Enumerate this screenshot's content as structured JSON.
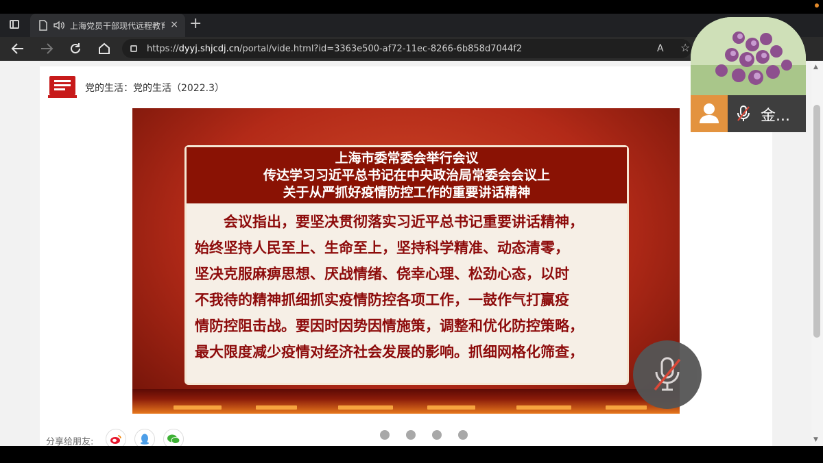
{
  "browser": {
    "tab_title": "上海党员干部现代远程教育",
    "tab_close": "×",
    "new_tab": "+",
    "url_prefix": "https://",
    "url_host": "dyyj.shjcdj.cn",
    "url_path": "/portal/vide.html?id=3363e500-af72-11ec-8266-6b858d7044f2",
    "read_aloud": "A",
    "favorite": "☆"
  },
  "page": {
    "breadcrumb": "党的生活：党的生活（2022.3）",
    "share_label": "分享给朋友:",
    "carousel_dots": 4
  },
  "video": {
    "headline": [
      "上海市委常委会举行会议",
      "传达学习习近平总书记在中央政治局常委会会议上",
      "关于从严抓好疫情防控工作的重要讲话精神"
    ],
    "body": [
      "　　会议指出，要坚决贯彻落实习近平总书记重要讲话精神，",
      "始终坚持人民至上、生命至上，坚持科学精准、动态清零，",
      "坚决克服麻痹思想、厌战情绪、侥幸心理、松劲心态，以时",
      "不我待的精神抓细抓实疫情防控各项工作，一鼓作气打赢疫",
      "情防控阻击战。要因时因势因情施策，调整和优化防控策略，",
      "最大限度减少疫情对经济社会发展的影响。抓细网格化筛查，"
    ]
  },
  "meeting": {
    "participant_name": "金..."
  },
  "colors": {
    "accent_red": "#8a1204",
    "panel_text": "#8d0b0b",
    "user_tile": "#e3933f"
  }
}
